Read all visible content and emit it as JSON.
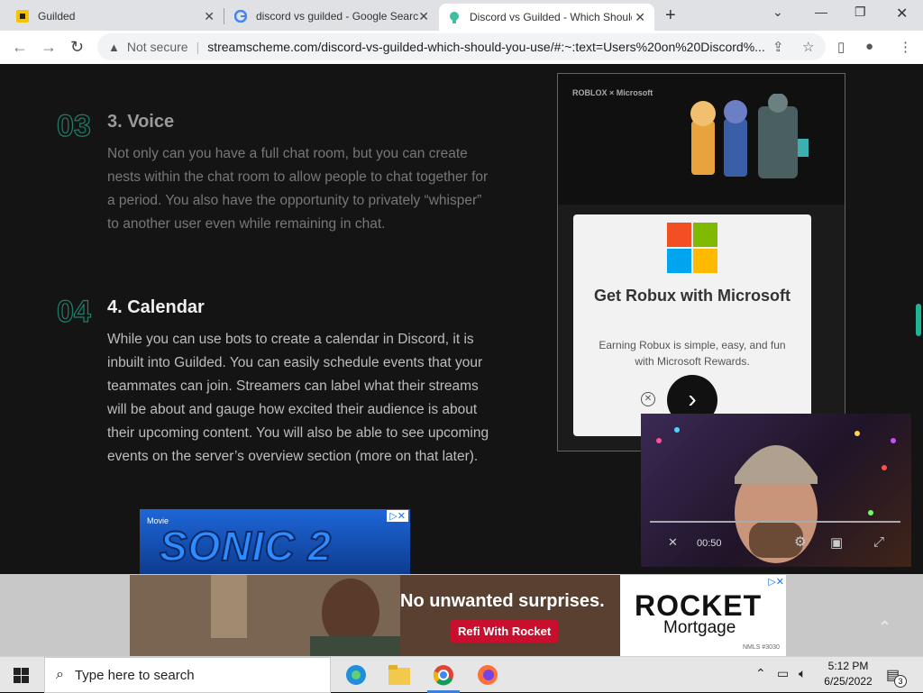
{
  "tabs": [
    {
      "title": "Guilded"
    },
    {
      "title": "discord vs guilded - Google Search"
    },
    {
      "title": "Discord vs Guilded - Which Should You Use"
    }
  ],
  "omnibox": {
    "security": "Not secure",
    "url": "streamscheme.com/discord-vs-guilded-which-should-you-use/#:~:text=Users%20on%20Discord%..."
  },
  "article": {
    "sections": [
      {
        "num": "03",
        "heading": "3. Voice",
        "body": "Not only can you have a full chat room, but you can create nests within the chat room to allow people to chat together for a period. You also have the opportunity to privately “whisper” to another user even while remaining in chat."
      },
      {
        "num": "04",
        "heading": "4. Calendar",
        "body": "While you can use bots to create a calendar in Discord, it is inbuilt into Guilded. You can easily schedule events that your teammates can join. Streamers can label what their streams will be about and gauge how excited their audience is about their upcoming content. You will also be able to see upcoming events on the server’s overview section (more on that later)."
      }
    ]
  },
  "ad_microsoft": {
    "brand": "ROBLOX × Microsoft",
    "title": "Get Robux with Microsoft",
    "subtitle": "Earning Robux is simple, easy, and fun with Microsoft Rewards.",
    "colors": [
      "#f25022",
      "#7fba00",
      "#00a4ef",
      "#ffb900"
    ]
  },
  "video": {
    "time": "00:50"
  },
  "ad_sonic": {
    "badge": "Movie",
    "title": "SONIC 2"
  },
  "ad_rocket": {
    "headline": "No unwanted surprises.",
    "cta": "Refi With Rocket",
    "brand_top": "ROCKET",
    "brand_bottom": "Mortgage",
    "nmls": "NMLS #3030"
  },
  "taskbar": {
    "search_placeholder": "Type here to search",
    "time": "5:12 PM",
    "date": "6/25/2022",
    "notifications": "3"
  }
}
